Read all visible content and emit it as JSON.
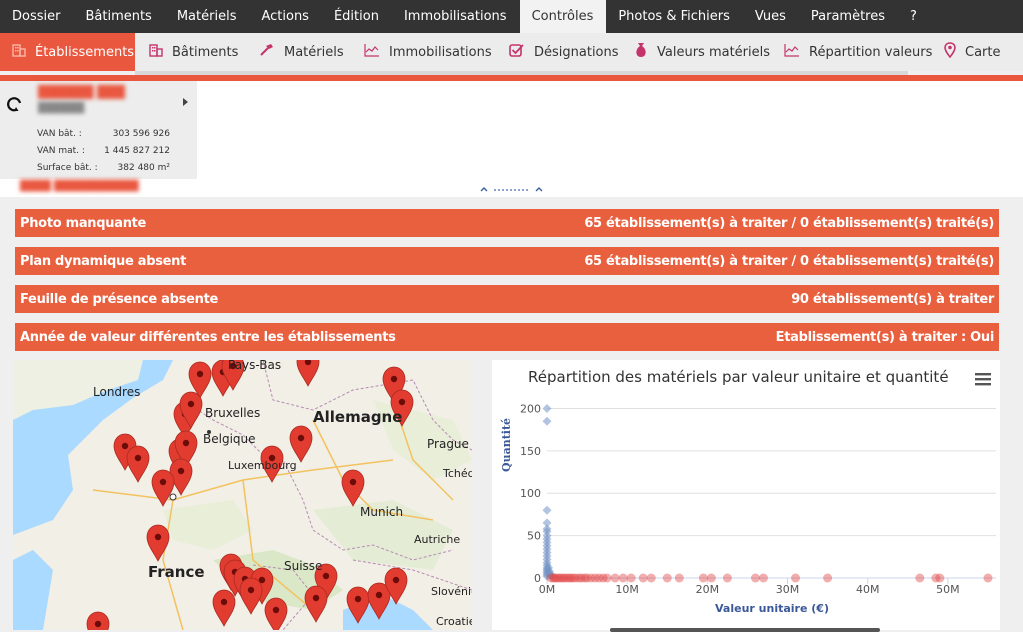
{
  "menu": [
    "Dossier",
    "Bâtiments",
    "Matériels",
    "Actions",
    "Édition",
    "Immobilisations",
    "Contrôles",
    "Photos & Fichiers",
    "Vues",
    "Paramètres",
    "?"
  ],
  "menu_active": "Contrôles",
  "submenu": [
    {
      "label": "Établissements",
      "icon": "building-icon",
      "active": true
    },
    {
      "label": "Bâtiments",
      "icon": "building-icon"
    },
    {
      "label": "Matériels",
      "icon": "hammer-icon"
    },
    {
      "label": "Immobilisations",
      "icon": "chart-icon"
    },
    {
      "label": "Désignations",
      "icon": "checkbox-icon"
    },
    {
      "label": "Valeurs matériels",
      "icon": "money-bag-icon"
    },
    {
      "label": "Répartition valeurs",
      "icon": "chart-icon"
    },
    {
      "label": "Carte",
      "icon": "map-pin-icon"
    }
  ],
  "summary": {
    "stats": [
      {
        "label": "VAN bât. :",
        "value": "303 596 926"
      },
      {
        "label": "VAN mat. :",
        "value": "1 445 827 212"
      },
      {
        "label": "Surface bât. :",
        "value": "382 480 m²"
      }
    ]
  },
  "controls": [
    {
      "label": "Photo manquante",
      "status": "65 établissement(s) à traiter / 0 établissement(s) traité(s)"
    },
    {
      "label": "Plan dynamique absent",
      "status": "65 établissement(s) à traiter / 0 établissement(s) traité(s)"
    },
    {
      "label": "Feuille de présence absente",
      "status": "90 établissement(s) à traiter"
    },
    {
      "label": "Année de valeur différentes entre les établissements",
      "status": "Etablissement(s) à traiter : Oui"
    }
  ],
  "map": {
    "labels": [
      "Londres",
      "Pays-Bas",
      "Bruxelles",
      "Belgique",
      "Luxembourg",
      "Allemagne",
      "Prague",
      "Tchéquie",
      "Munich",
      "Autriche",
      "France",
      "Suisse",
      "Slovénie",
      "Croatie"
    ]
  },
  "colors": {
    "accent": "#e9573f",
    "banner": "#e9603f",
    "menubar": "#333333",
    "scatter_blue": "#7393c4",
    "scatter_red": "#e34a4a"
  },
  "chart_data": {
    "type": "scatter",
    "title": "Répartition des matériels par valeur unitaire et quantité",
    "xlabel": "Valeur unitaire (€)",
    "ylabel": "Quantité",
    "xlim": [
      0,
      56000000
    ],
    "ylim": [
      0,
      210
    ],
    "xticks": [
      "0M",
      "10M",
      "20M",
      "30M",
      "40M",
      "50M"
    ],
    "yticks": [
      "0",
      "50",
      "100",
      "150",
      "200"
    ],
    "grid": true,
    "series": [
      {
        "values": [
          [
            0,
            200
          ],
          [
            0,
            185
          ],
          [
            0,
            80
          ],
          [
            0,
            65
          ],
          [
            0,
            58
          ],
          [
            0,
            55
          ],
          [
            0,
            50
          ],
          [
            0,
            46
          ],
          [
            0,
            42
          ],
          [
            0,
            38
          ],
          [
            0,
            34
          ],
          [
            0,
            30
          ],
          [
            0,
            26
          ],
          [
            0,
            22
          ],
          [
            0,
            18
          ],
          [
            0,
            15
          ],
          [
            0,
            12
          ],
          [
            0,
            10
          ],
          [
            0,
            8
          ],
          [
            0,
            6
          ],
          [
            0,
            4
          ],
          [
            0,
            2
          ],
          [
            200000,
            12
          ],
          [
            300000,
            8
          ],
          [
            400000,
            5
          ],
          [
            500000,
            3
          ],
          [
            600000,
            2
          ]
        ]
      },
      {
        "values": [
          [
            500000,
            0
          ],
          [
            800000,
            0
          ],
          [
            1000000,
            0
          ],
          [
            1200000,
            0
          ],
          [
            1500000,
            0
          ],
          [
            1700000,
            0
          ],
          [
            2000000,
            0
          ],
          [
            2200000,
            0
          ],
          [
            2500000,
            0
          ],
          [
            2800000,
            0
          ],
          [
            3000000,
            0
          ],
          [
            3300000,
            0
          ],
          [
            3600000,
            0
          ],
          [
            4000000,
            0
          ],
          [
            4300000,
            0
          ],
          [
            4700000,
            0
          ],
          [
            5000000,
            0
          ],
          [
            5500000,
            0
          ],
          [
            6000000,
            0
          ],
          [
            6500000,
            0
          ],
          [
            7000000,
            0
          ],
          [
            7500000,
            0
          ],
          [
            8500000,
            0
          ],
          [
            9500000,
            0
          ],
          [
            10500000,
            0
          ],
          [
            12000000,
            0
          ],
          [
            13000000,
            0
          ],
          [
            15000000,
            0
          ],
          [
            16500000,
            0
          ],
          [
            19500000,
            0
          ],
          [
            20500000,
            0
          ],
          [
            22500000,
            0
          ],
          [
            26000000,
            0
          ],
          [
            27000000,
            0
          ],
          [
            31000000,
            0
          ],
          [
            35000000,
            0
          ],
          [
            46500000,
            0
          ],
          [
            48500000,
            0
          ],
          [
            49000000,
            0
          ],
          [
            55000000,
            0
          ]
        ]
      }
    ]
  }
}
